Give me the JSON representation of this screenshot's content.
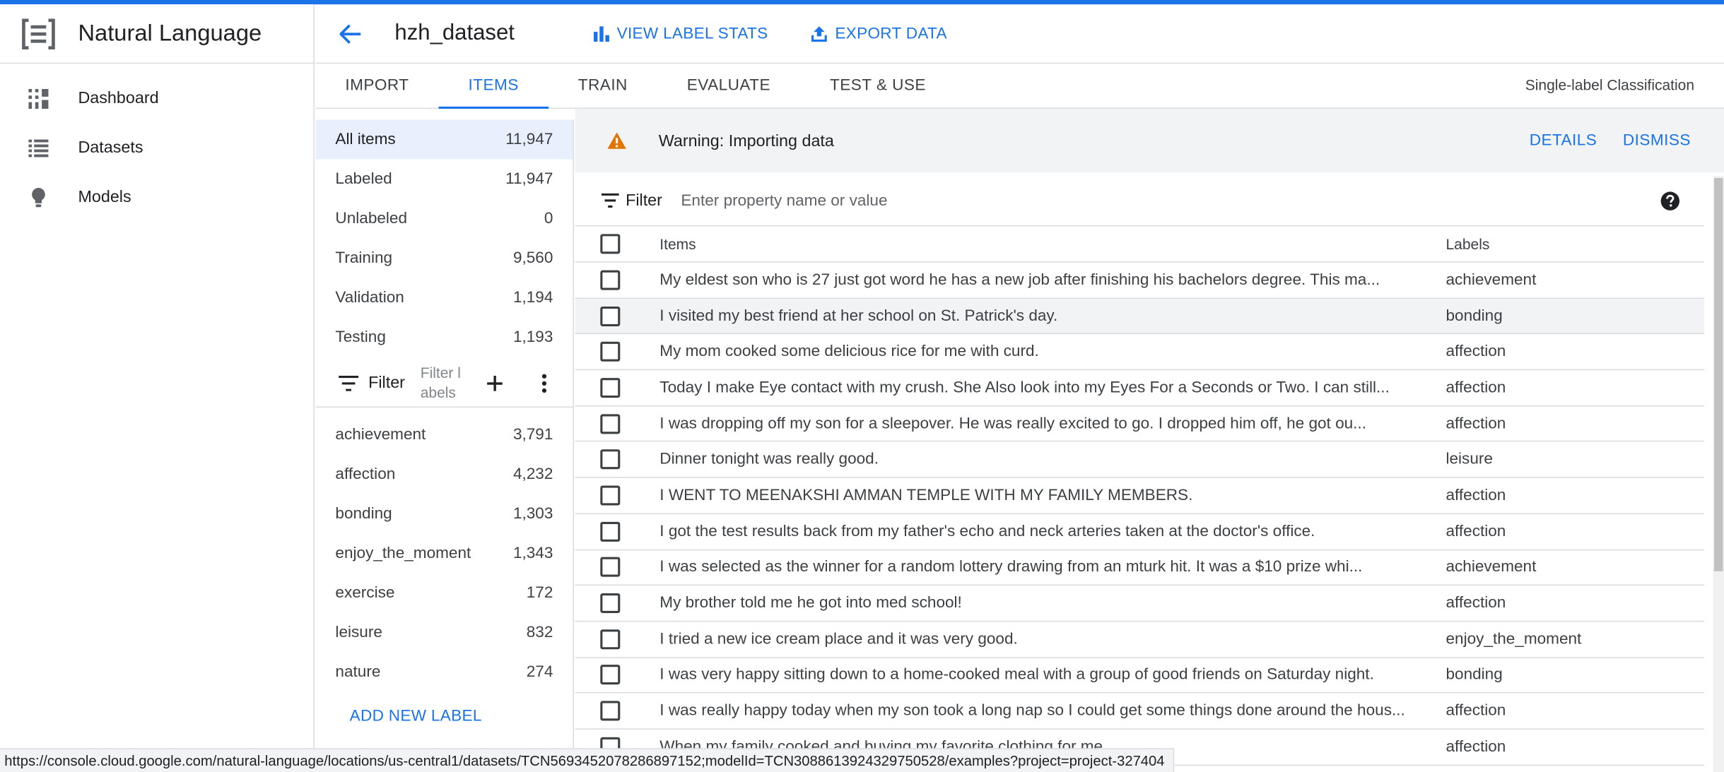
{
  "app": {
    "title": "Natural Language",
    "accent_color": "#1a73e8",
    "nav": [
      {
        "label": "Dashboard",
        "icon": "dashboard-icon"
      },
      {
        "label": "Datasets",
        "icon": "list-icon"
      },
      {
        "label": "Models",
        "icon": "lightbulb-icon"
      }
    ],
    "collapse_label": "<|"
  },
  "header": {
    "dataset_name": "hzh_dataset",
    "view_label_stats": "VIEW LABEL STATS",
    "export_data": "EXPORT DATA"
  },
  "tabs": {
    "items": [
      "IMPORT",
      "ITEMS",
      "TRAIN",
      "EVALUATE",
      "TEST & USE"
    ],
    "active": "ITEMS",
    "mode": "Single-label Classification"
  },
  "left_panel": {
    "summary": [
      {
        "label": "All items",
        "count": "11,947"
      },
      {
        "label": "Labeled",
        "count": "11,947"
      },
      {
        "label": "Unlabeled",
        "count": "0"
      },
      {
        "label": "Training",
        "count": "9,560"
      },
      {
        "label": "Validation",
        "count": "1,194"
      },
      {
        "label": "Testing",
        "count": "1,193"
      }
    ],
    "filter_label": "Filter",
    "filter_placeholder": "Filter labels",
    "labels": [
      {
        "label": "achievement",
        "count": "3,791"
      },
      {
        "label": "affection",
        "count": "4,232"
      },
      {
        "label": "bonding",
        "count": "1,303"
      },
      {
        "label": "enjoy_the_moment",
        "count": "1,343"
      },
      {
        "label": "exercise",
        "count": "172"
      },
      {
        "label": "leisure",
        "count": "832"
      },
      {
        "label": "nature",
        "count": "274"
      }
    ],
    "add_new_label": "ADD NEW LABEL"
  },
  "warning": {
    "text": "Warning: Importing data",
    "details": "DETAILS",
    "dismiss": "DISMISS",
    "color": "#e37400"
  },
  "filter_bar": {
    "label": "Filter",
    "placeholder": "Enter property name or value"
  },
  "table": {
    "columns": {
      "items": "Items",
      "labels": "Labels"
    },
    "rows": [
      {
        "text": "My eldest son who is 27 just got word he has a new job after finishing his bachelors degree. This ma...",
        "label": "achievement"
      },
      {
        "text": "I visited my best friend at her school on St. Patrick's day.",
        "label": "bonding"
      },
      {
        "text": "My mom cooked some delicious rice for me with curd.",
        "label": "affection"
      },
      {
        "text": "Today I make Eye contact with my crush. She Also look into my Eyes For a Seconds or Two. I can still...",
        "label": "affection"
      },
      {
        "text": "I was dropping off my son for a sleepover. He was really excited to go. I dropped him off, he got ou...",
        "label": "affection"
      },
      {
        "text": "Dinner tonight was really good.",
        "label": "leisure"
      },
      {
        "text": "I WENT TO MEENAKSHI AMMAN TEMPLE WITH MY FAMILY MEMBERS.",
        "label": "affection"
      },
      {
        "text": "I got the test results back from my father's echo and neck arteries taken at the doctor's office.",
        "label": "affection"
      },
      {
        "text": "I was selected as the winner for a random lottery drawing from an mturk hit. It was a $10 prize whi...",
        "label": "achievement"
      },
      {
        "text": "My brother told me he got into med school!",
        "label": "affection"
      },
      {
        "text": "I tried a new ice cream place and it was very good.",
        "label": "enjoy_the_moment"
      },
      {
        "text": "I was very happy sitting down to a home-cooked meal with a group of good friends on Saturday night.",
        "label": "bonding"
      },
      {
        "text": "I was really happy today when my son took a long nap so I could get some things done around the hous...",
        "label": "affection"
      },
      {
        "text": "When my family cooked and buying my favorite clothing for me",
        "label": "affection"
      }
    ]
  },
  "status_url": "https://console.cloud.google.com/natural-language/locations/us-central1/datasets/TCN5693452078286897152;modelId=TCN3088613924329750528/examples?project=project-327404"
}
